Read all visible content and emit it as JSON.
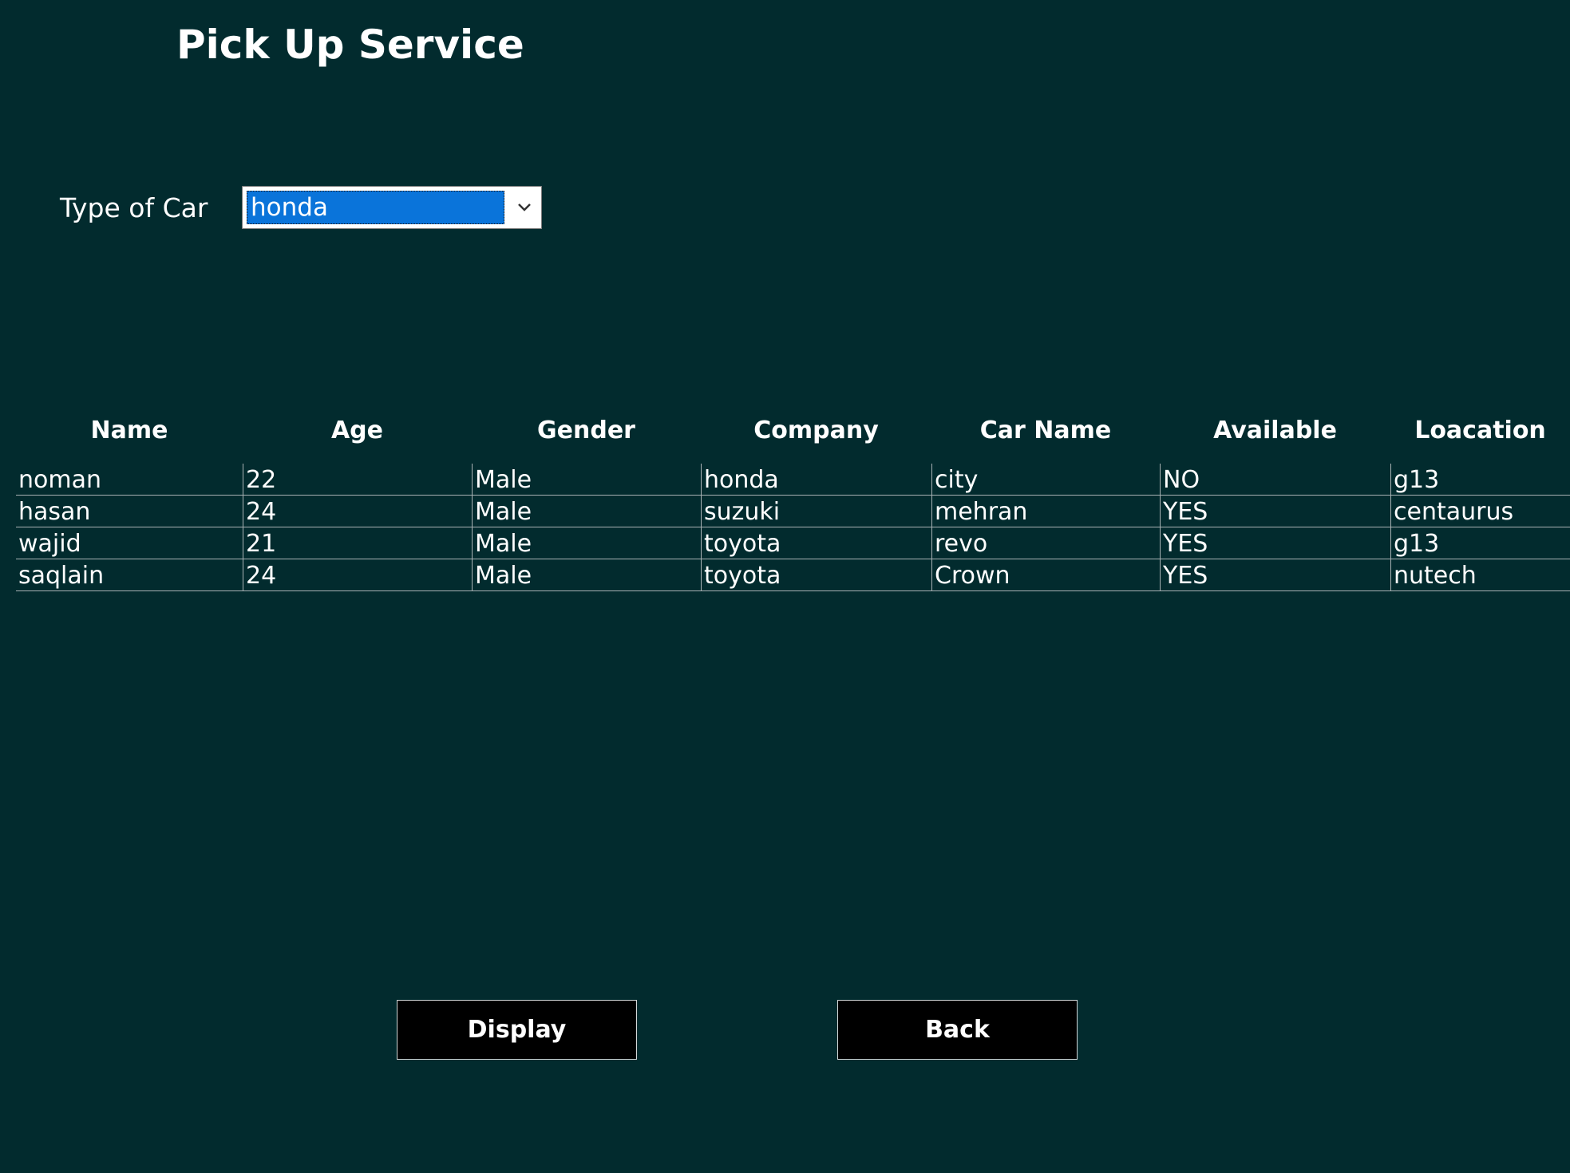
{
  "header": {
    "title": "Pick Up Service"
  },
  "filter": {
    "label": "Type of Car",
    "selected": "honda",
    "icon": "chevron-down-icon"
  },
  "table": {
    "columns": [
      "Name",
      "Age",
      "Gender",
      "Company",
      "Car Name",
      "Available",
      "Loacation"
    ],
    "rows": [
      [
        "noman",
        "22",
        "Male",
        "honda",
        "city",
        "NO",
        "g13"
      ],
      [
        "hasan",
        "24",
        "Male",
        "suzuki",
        "mehran",
        "YES",
        "centaurus"
      ],
      [
        "wajid",
        "21",
        "Male",
        "toyota",
        "revo",
        "YES",
        "g13"
      ],
      [
        "saqlain",
        "24",
        "Male",
        "toyota",
        "Crown",
        "YES",
        "nutech"
      ]
    ]
  },
  "actions": {
    "display_label": "Display",
    "back_label": "Back"
  },
  "colors": {
    "background": "#022b2e",
    "selection": "#0a74da",
    "button": "#000000",
    "text": "#ffffff"
  }
}
